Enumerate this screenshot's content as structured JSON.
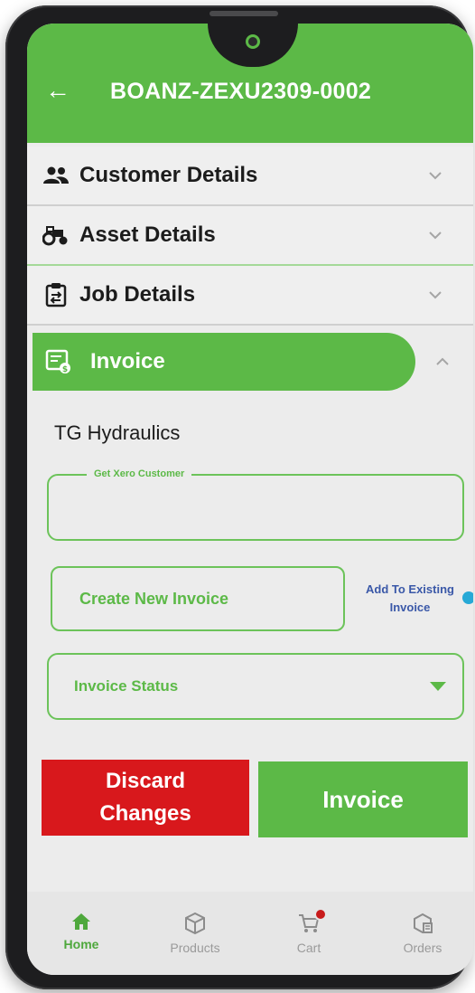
{
  "header": {
    "title": "BOANZ-ZEXU2309-0002",
    "back_icon": "arrow-left-icon"
  },
  "sections": [
    {
      "label": "Customer Details",
      "icon": "people-icon",
      "expanded": false
    },
    {
      "label": "Asset Details",
      "icon": "tractor-icon",
      "expanded": false
    },
    {
      "label": "Job Details",
      "icon": "clipboard-transfer-icon",
      "expanded": false
    }
  ],
  "invoice_section": {
    "label": "Invoice",
    "icon": "invoice-icon",
    "expanded": true,
    "customer_name": "TG Hydraulics",
    "xero_field": {
      "label": "Get Xero Customer",
      "value": ""
    },
    "create_button": "Create New Invoice",
    "add_existing_link": "Add To Existing Invoice",
    "status_select": {
      "placeholder": "Invoice Status"
    }
  },
  "actions": {
    "discard": "Discard Changes",
    "invoice": "Invoice"
  },
  "bottom_nav": [
    {
      "label": "Home",
      "icon": "home-icon",
      "active": true
    },
    {
      "label": "Products",
      "icon": "box-icon",
      "active": false
    },
    {
      "label": "Cart",
      "icon": "cart-icon",
      "active": false
    },
    {
      "label": "Orders",
      "icon": "orders-icon",
      "active": false
    }
  ],
  "colors": {
    "brand_green": "#5cb947",
    "discard_red": "#d8181c",
    "link_blue": "#3a58a8",
    "indicator_dot": "#27a9d6"
  }
}
